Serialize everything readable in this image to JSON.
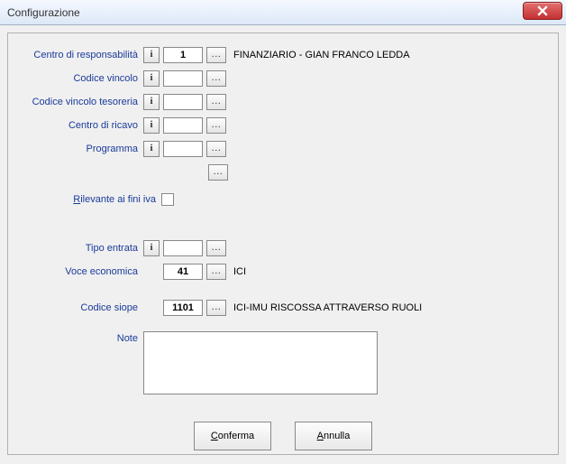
{
  "window": {
    "title": "Configurazione"
  },
  "buttons": {
    "info": "i",
    "lookup": "...",
    "confirm_html": "<span class='underline'>C</span>onferma",
    "cancel_html": "<span class='underline'>A</span>nnulla"
  },
  "rows": {
    "centro_resp": {
      "label": "Centro di responsabilità",
      "value": "1",
      "desc": "FINANZIARIO - GIAN FRANCO LEDDA"
    },
    "codice_vincolo": {
      "label": "Codice vincolo",
      "value": ""
    },
    "codice_vincolo_tesoreria": {
      "label": "Codice vincolo tesoreria",
      "value": ""
    },
    "centro_ricavo": {
      "label": "Centro di ricavo",
      "value": ""
    },
    "programma": {
      "label": "Programma",
      "value": ""
    },
    "rilevante_iva": {
      "label_html": "<span class='underline'>R</span>ilevante ai fini iva",
      "checked": false
    },
    "tipo_entrata": {
      "label": "Tipo entrata",
      "value": ""
    },
    "voce_economica": {
      "label": "Voce economica",
      "value": "41",
      "desc": "ICI"
    },
    "codice_siope": {
      "label": "Codice siope",
      "value": "1101",
      "desc": "ICI-IMU RISCOSSA ATTRAVERSO RUOLI"
    },
    "note": {
      "label": "Note",
      "value": ""
    }
  }
}
